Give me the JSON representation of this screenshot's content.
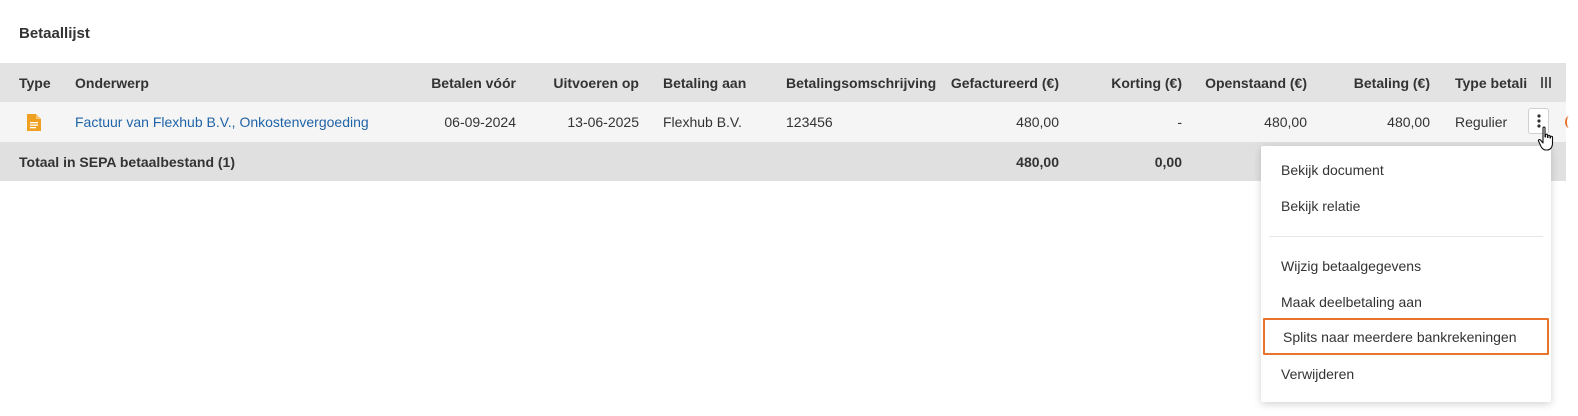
{
  "page": {
    "title": "Betaallijst"
  },
  "table": {
    "headers": {
      "type": "Type",
      "onderwerp": "Onderwerp",
      "betalen_voor": "Betalen vóór",
      "uitvoeren_op": "Uitvoeren op",
      "betaling_aan": "Betaling aan",
      "betalingsomschrijving": "Betalingsomschrijving",
      "gefactureerd": "Gefactureerd (€)",
      "korting": "Korting (€)",
      "openstaand": "Openstaand (€)",
      "betaling": "Betaling (€)",
      "type_betaling": "Type betali"
    },
    "row": {
      "type_icon": "document-icon",
      "onderwerp": "Factuur van Flexhub B.V., Onkostenvergoeding",
      "betalen_voor": "06-09-2024",
      "uitvoeren_op": "13-06-2025",
      "betaling_aan": "Flexhub B.V.",
      "betalingsomschrijving": "123456",
      "gefactureerd": "480,00",
      "korting": "-",
      "openstaand": "480,00",
      "betaling": "480,00",
      "type_betaling": "Regulier"
    },
    "total": {
      "label": "Totaal in SEPA betaalbestand (1)",
      "gefactureerd": "480,00",
      "korting": "0,00"
    }
  },
  "context_menu": {
    "items": [
      "Bekijk document",
      "Bekijk relatie",
      "Wijzig betaalgegevens",
      "Maak deelbetaling aan",
      "Splits naar meerdere bankrekeningen",
      "Verwijderen"
    ],
    "highlighted": "Splits naar meerdere bankrekeningen"
  },
  "colors": {
    "link": "#1f63a8",
    "icon_orange": "#f0a020",
    "highlight_border": "#e8732a",
    "header_bg": "#e3e3e3",
    "row_bg": "#f5f5f5"
  }
}
